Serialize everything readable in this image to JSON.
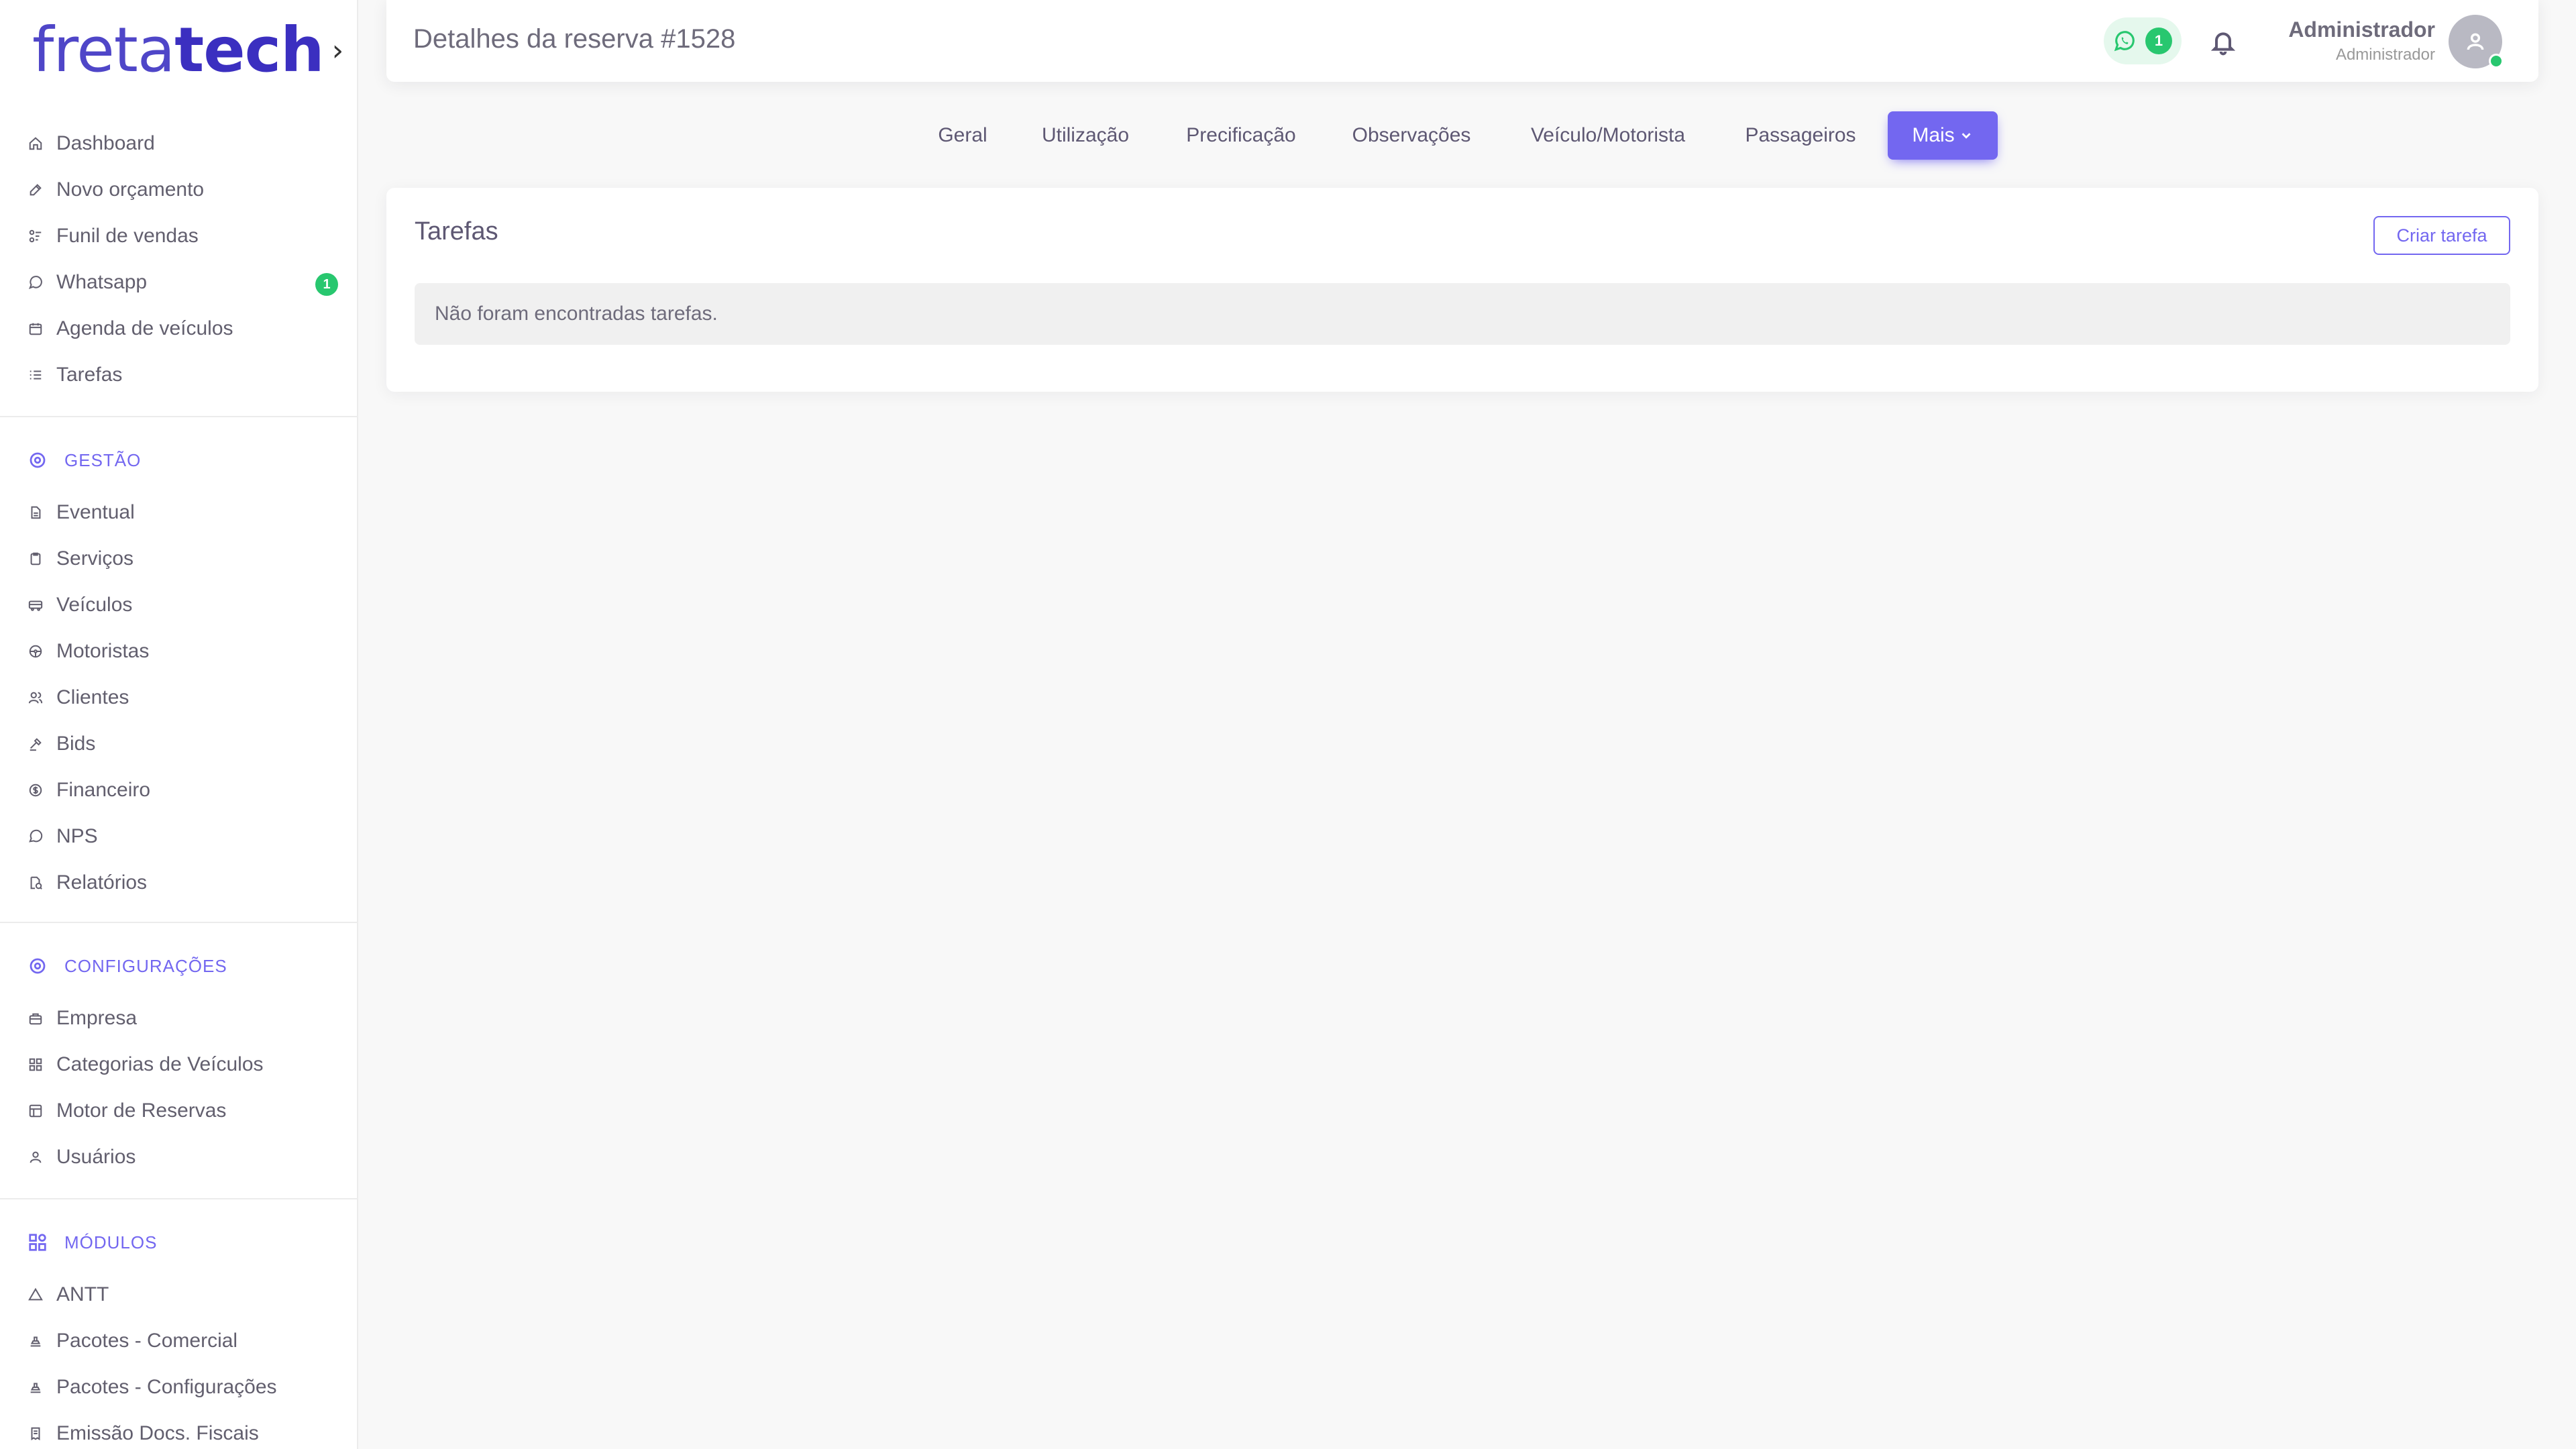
{
  "brand": {
    "name_light": "freta",
    "name_bold": "tech"
  },
  "header": {
    "title": "Detalhes da reserva #1528",
    "whatsapp_count": "1",
    "user_name": "Administrador",
    "user_role": "Administrador"
  },
  "sidebar": {
    "main_items": [
      {
        "label": "Dashboard",
        "icon": "home-icon"
      },
      {
        "label": "Novo orçamento",
        "icon": "edit-icon"
      },
      {
        "label": "Funil de vendas",
        "icon": "funnel-icon"
      },
      {
        "label": "Whatsapp",
        "icon": "whatsapp-icon",
        "badge": "1"
      },
      {
        "label": "Agenda de veículos",
        "icon": "calendar-icon"
      },
      {
        "label": "Tarefas",
        "icon": "list-icon"
      }
    ],
    "gestao": {
      "title": "GESTÃO",
      "items": [
        {
          "label": "Eventual",
          "icon": "file-icon"
        },
        {
          "label": "Serviços",
          "icon": "clipboard-icon"
        },
        {
          "label": "Veículos",
          "icon": "bus-icon"
        },
        {
          "label": "Motoristas",
          "icon": "steering-wheel-icon"
        },
        {
          "label": "Clientes",
          "icon": "users-icon"
        },
        {
          "label": "Bids",
          "icon": "gavel-icon"
        },
        {
          "label": "Financeiro",
          "icon": "coin-icon"
        },
        {
          "label": "NPS",
          "icon": "message-icon"
        },
        {
          "label": "Relatórios",
          "icon": "report-icon"
        }
      ]
    },
    "configuracoes": {
      "title": "CONFIGURAÇÕES",
      "items": [
        {
          "label": "Empresa",
          "icon": "building-icon"
        },
        {
          "label": "Categorias de Veículos",
          "icon": "grid-icon"
        },
        {
          "label": "Motor de Reservas",
          "icon": "table-icon"
        },
        {
          "label": "Usuários",
          "icon": "user-icon"
        }
      ]
    },
    "modulos": {
      "title": "MÓDULOS",
      "items": [
        {
          "label": "ANTT",
          "icon": "triangle-icon"
        },
        {
          "label": "Pacotes - Comercial",
          "icon": "package-icon"
        },
        {
          "label": "Pacotes - Configurações",
          "icon": "package-settings-icon"
        },
        {
          "label": "Emissão Docs. Fiscais",
          "icon": "receipt-icon"
        }
      ]
    }
  },
  "tabs": [
    {
      "label": "Geral"
    },
    {
      "label": "Utilização"
    },
    {
      "label": "Precificação"
    },
    {
      "label": "Observações"
    },
    {
      "label": "Veículo/Motorista"
    },
    {
      "label": "Passageiros"
    },
    {
      "label": "Mais",
      "active": true
    }
  ],
  "tasks": {
    "title": "Tarefas",
    "create_label": "Criar tarefa",
    "empty_message": "Não foram encontradas tarefas."
  },
  "colors": {
    "primary": "#7367f0",
    "success": "#28c76f",
    "text": "#5e5873"
  }
}
